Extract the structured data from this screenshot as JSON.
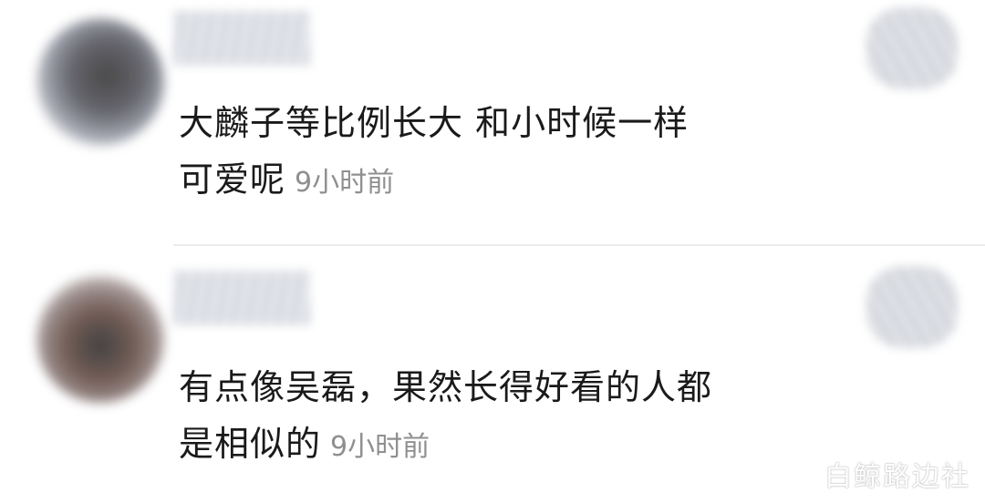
{
  "comments": [
    {
      "text_line1": "大麟子等比例长大 和小时候一样",
      "text_line2": "可爱呢",
      "time": "9小时前"
    },
    {
      "text_line1": "有点像吴磊，果然长得好看的人都",
      "text_line2": "是相似的",
      "time": "9小时前"
    }
  ],
  "watermark": "白鲸路边社",
  "icons": {
    "avatar": "avatar-blurred",
    "username": "username-blurred",
    "like": "like-icon-blurred"
  }
}
